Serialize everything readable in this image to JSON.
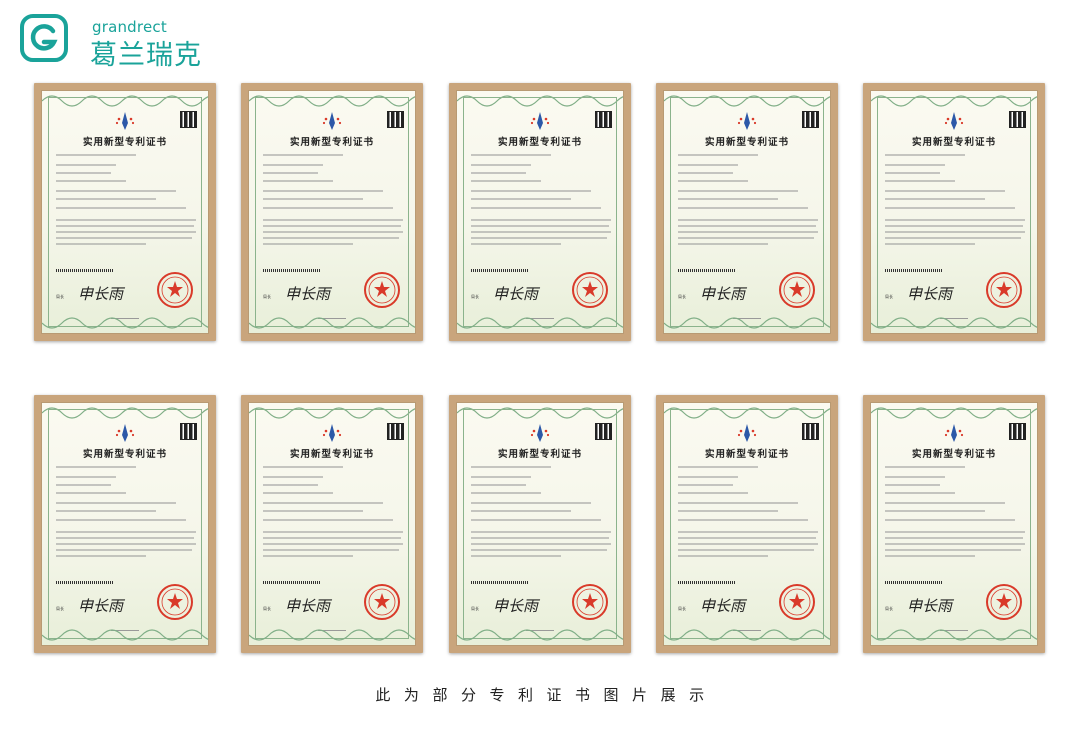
{
  "brand": {
    "name_en": "grandrect",
    "name_cn": "葛兰瑞克",
    "color": "#1aa39a"
  },
  "certificate_title": "实用新型专利证书",
  "certificates": [
    {
      "id": 1
    },
    {
      "id": 2
    },
    {
      "id": 3
    },
    {
      "id": 4
    },
    {
      "id": 5
    },
    {
      "id": 6
    },
    {
      "id": 7
    },
    {
      "id": 8
    },
    {
      "id": 9
    },
    {
      "id": 10
    }
  ],
  "signature": "申长雨",
  "caption": "此为部分专利证书图片展示",
  "colors": {
    "frame": "#c9a57c",
    "seal": "#d93a2a",
    "border_green": "#8bb38c"
  }
}
